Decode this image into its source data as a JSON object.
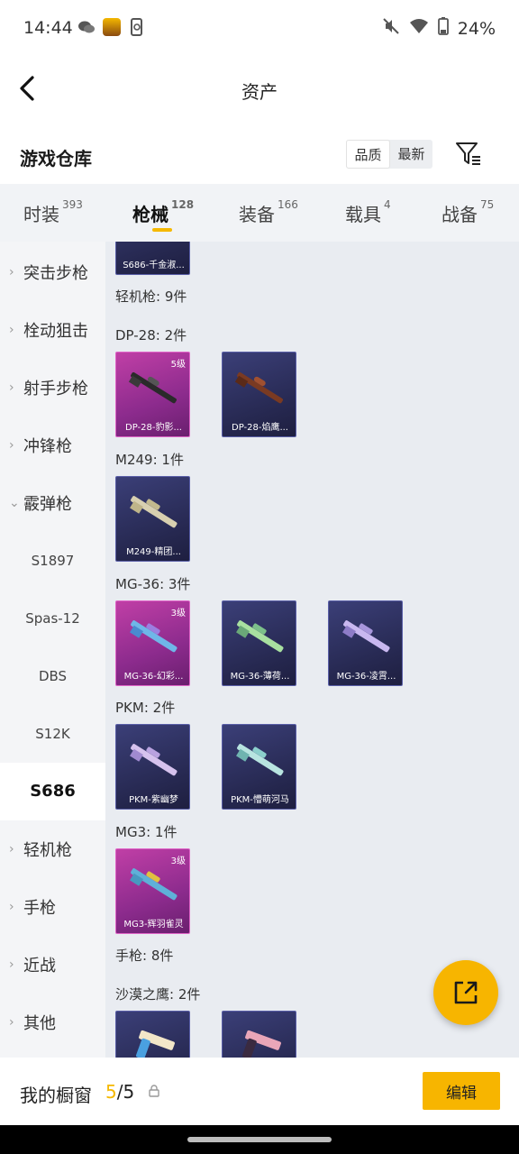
{
  "status": {
    "time": "14:44",
    "battery": "24%"
  },
  "header": {
    "title": "资产"
  },
  "warehouse": {
    "title": "游戏仓库",
    "sort_quality": "品质",
    "sort_latest": "最新"
  },
  "tabs": [
    {
      "label": "时装",
      "count": "393"
    },
    {
      "label": "枪械",
      "count": "128"
    },
    {
      "label": "装备",
      "count": "166"
    },
    {
      "label": "载具",
      "count": "4"
    },
    {
      "label": "战备",
      "count": "75"
    }
  ],
  "sidebar": {
    "items": [
      "突击步枪",
      "栓动狙击",
      "射手步枪",
      "冲锋枪",
      "霰弹枪"
    ],
    "subitems": [
      "S1897",
      "Spas-12",
      "DBS",
      "S12K",
      "S686"
    ],
    "items_after": [
      "轻机枪",
      "手枪",
      "近战",
      "其他"
    ]
  },
  "content": {
    "top_card": "S686-千金淑...",
    "group_lmg": "轻机枪: 9件",
    "dp28": {
      "label": "DP-28: 2件",
      "cards": [
        {
          "name": "DP-28-豹影...",
          "level": "5级"
        },
        {
          "name": "DP-28-焰鹰..."
        }
      ]
    },
    "m249": {
      "label": "M249: 1件",
      "cards": [
        {
          "name": "M249-精团..."
        }
      ]
    },
    "mg36": {
      "label": "MG-36: 3件",
      "cards": [
        {
          "name": "MG-36-幻彩...",
          "level": "3级"
        },
        {
          "name": "MG-36-薄荷..."
        },
        {
          "name": "MG-36-凌霄..."
        }
      ]
    },
    "pkm": {
      "label": "PKM: 2件",
      "cards": [
        {
          "name": "PKM-紫幽梦"
        },
        {
          "name": "PKM-懵萌河马"
        }
      ]
    },
    "mg3": {
      "label": "MG3: 1件",
      "cards": [
        {
          "name": "MG3-辉羽雀灵",
          "level": "3级"
        }
      ]
    },
    "group_pistol": "手枪: 8件",
    "deagle": {
      "label": "沙漠之鹰: 2件"
    }
  },
  "bottom": {
    "showcase_label": "我的橱窗",
    "count_current": "5",
    "count_total": "/5",
    "edit_label": "编辑"
  },
  "colors": {
    "accent": "#f5b800",
    "card_blue": "#2b2d5c",
    "card_pink": "#a8369a"
  }
}
